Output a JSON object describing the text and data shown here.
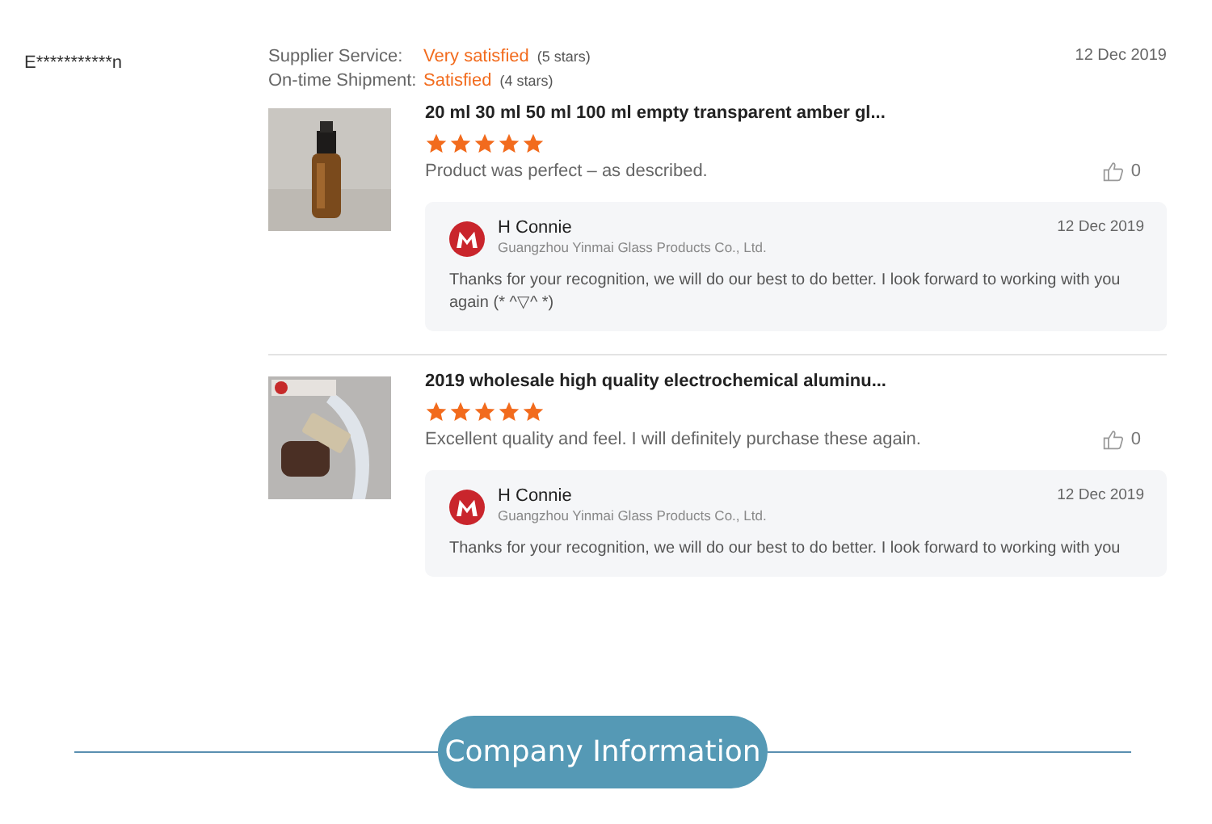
{
  "review": {
    "reviewer": "E***********n",
    "date": "12 Dec 2019",
    "ratings": [
      {
        "label": "Supplier Service:",
        "value": "Very satisfied",
        "note": "(5 stars)"
      },
      {
        "label": "On-time Shipment:",
        "value": "Satisfied",
        "note": "(4 stars)"
      }
    ],
    "products": [
      {
        "title": "20 ml 30 ml 50 ml 100 ml empty transparent amber gl...",
        "stars": 5,
        "comment": "Product was perfect – as described.",
        "likes": "0",
        "reply": {
          "name": "H Connie",
          "company": "Guangzhou Yinmai Glass Products Co., Ltd.",
          "date": "12 Dec 2019",
          "text": "Thanks for your recognition, we will do our best to do better. I look forward to working with you again (* ^▽^ *)"
        }
      },
      {
        "title": "2019 wholesale high quality electrochemical aluminu...",
        "stars": 5,
        "comment": "Excellent quality and feel. I will definitely purchase these again.",
        "likes": "0",
        "reply": {
          "name": "H Connie",
          "company": "Guangzhou Yinmai Glass Products Co., Ltd.",
          "date": "12 Dec 2019",
          "text": "Thanks for your recognition, we will do our best to do better. I look forward to working with you"
        }
      }
    ]
  },
  "section": {
    "title": "Company Information"
  }
}
